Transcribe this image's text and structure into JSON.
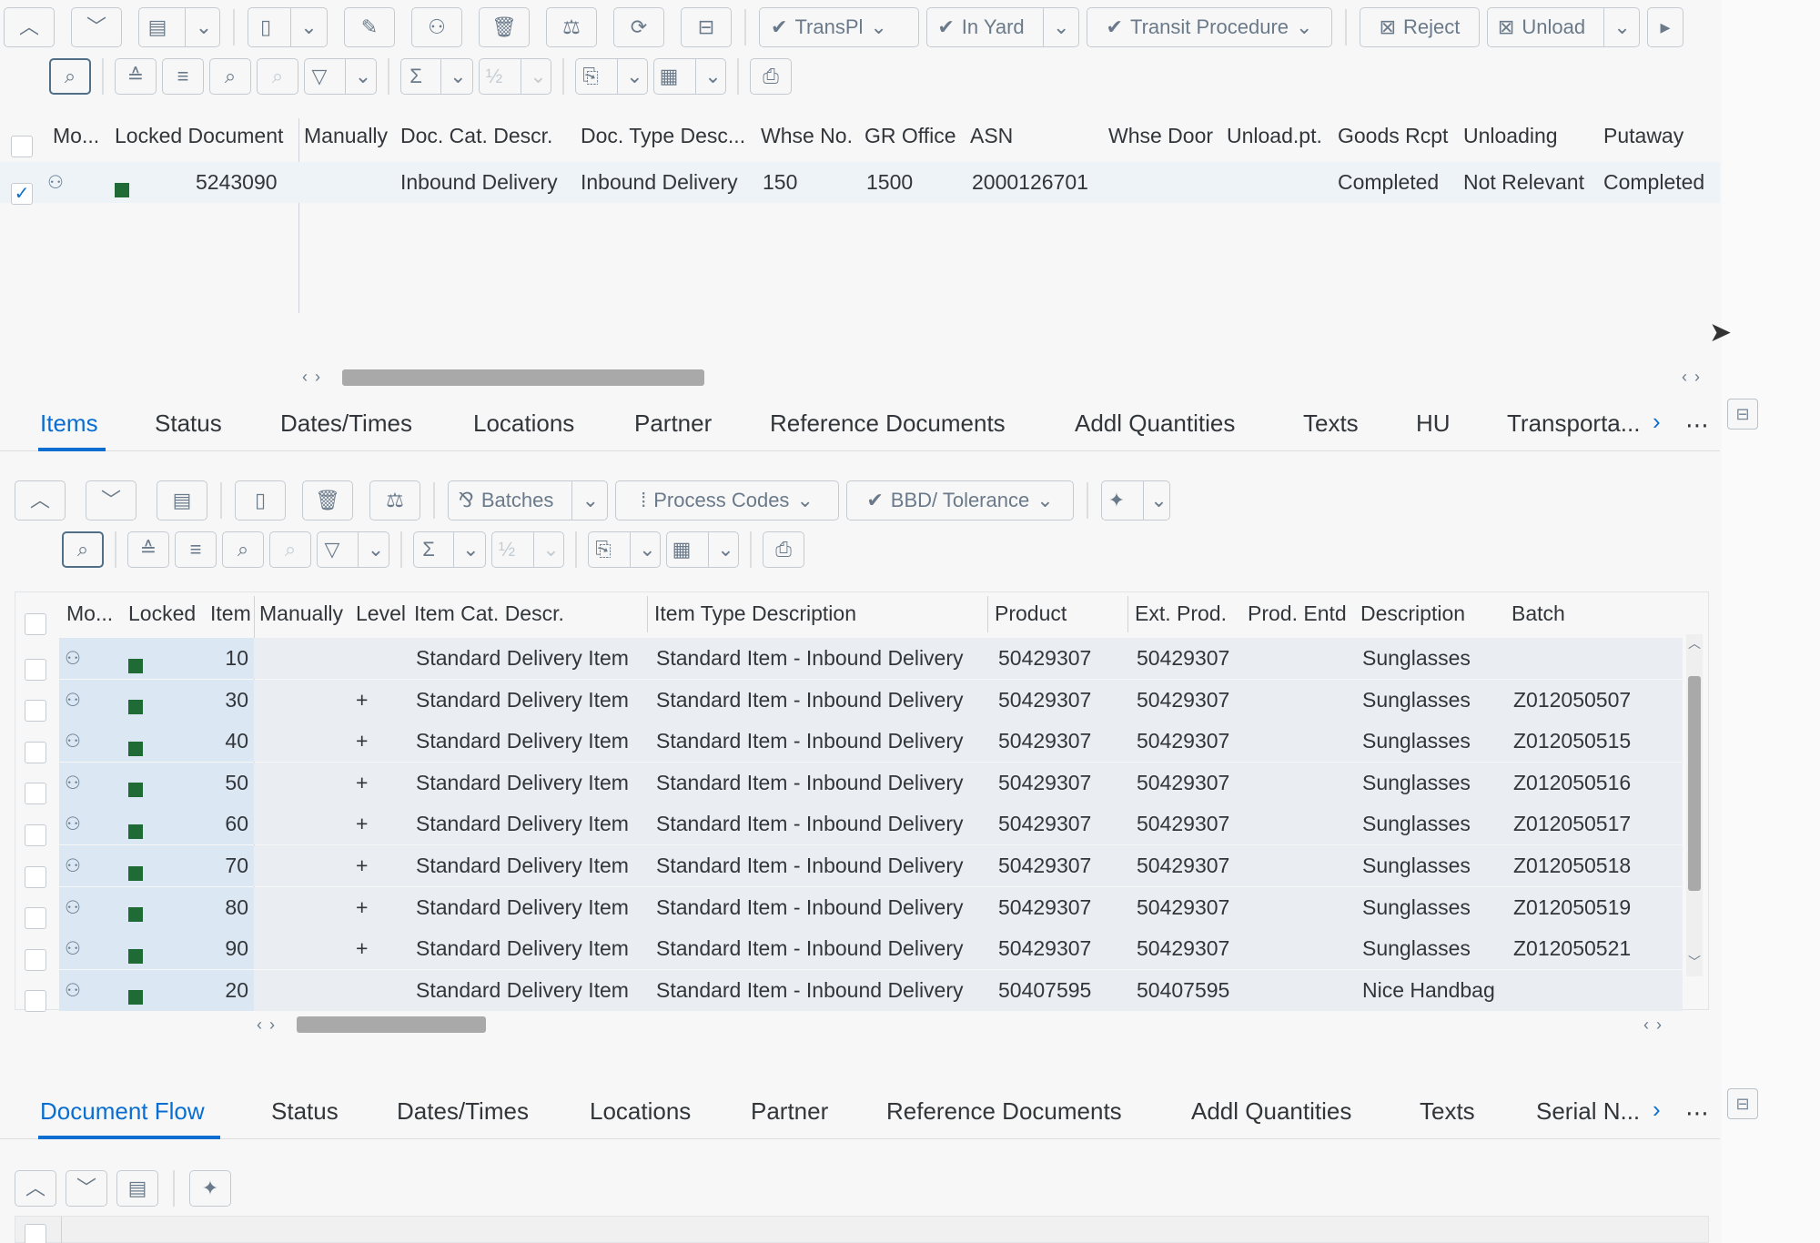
{
  "top_toolbar": {
    "transpl_label": "TransPl",
    "in_yard_label": "In Yard",
    "transit_label": "Transit Procedure",
    "reject_label": "Reject",
    "unload_label": "Unload"
  },
  "header_table": {
    "columns": [
      "Mo...",
      "Locked Document",
      "Manually",
      "Doc. Cat. Descr.",
      "Doc. Type Desc...",
      "Whse No.",
      "GR Office",
      "ASN",
      "Whse Door",
      "Unload.pt.",
      "Goods Rcpt",
      "Unloading",
      "Putaway"
    ],
    "row": {
      "document": "5243090",
      "doc_cat": "Inbound Delivery",
      "doc_type": "Inbound Delivery",
      "whse_no": "150",
      "gr_office": "1500",
      "asn": "2000126701",
      "goods_rcpt": "Completed",
      "unloading": "Not Relevant",
      "putaway": "Completed"
    }
  },
  "item_tabs": [
    "Items",
    "Status",
    "Dates/Times",
    "Locations",
    "Partner",
    "Reference Documents",
    "Addl Quantities",
    "Texts",
    "HU",
    "Transporta..."
  ],
  "item_toolbar": {
    "batches_label": "Batches",
    "process_codes_label": "Process Codes",
    "bbd_label": "BBD/ Tolerance"
  },
  "items_table": {
    "columns": [
      "Mo...",
      "Locked",
      "Item",
      "Manually",
      "Level",
      "Item Cat. Descr.",
      "Item Type Description",
      "Product",
      "Ext. Prod.",
      "Prod. Entd",
      "Description",
      "Batch"
    ],
    "rows": [
      {
        "item": "10",
        "level": "",
        "cat": "Standard Delivery Item",
        "type": "Standard Item - Inbound Delivery",
        "product": "50429307",
        "ext": "50429307",
        "desc": "Sunglasses",
        "batch": ""
      },
      {
        "item": "30",
        "level": "+",
        "cat": "Standard Delivery Item",
        "type": "Standard Item - Inbound Delivery",
        "product": "50429307",
        "ext": "50429307",
        "desc": "Sunglasses",
        "batch": "Z012050507"
      },
      {
        "item": "40",
        "level": "+",
        "cat": "Standard Delivery Item",
        "type": "Standard Item - Inbound Delivery",
        "product": "50429307",
        "ext": "50429307",
        "desc": "Sunglasses",
        "batch": "Z012050515"
      },
      {
        "item": "50",
        "level": "+",
        "cat": "Standard Delivery Item",
        "type": "Standard Item - Inbound Delivery",
        "product": "50429307",
        "ext": "50429307",
        "desc": "Sunglasses",
        "batch": "Z012050516"
      },
      {
        "item": "60",
        "level": "+",
        "cat": "Standard Delivery Item",
        "type": "Standard Item - Inbound Delivery",
        "product": "50429307",
        "ext": "50429307",
        "desc": "Sunglasses",
        "batch": "Z012050517"
      },
      {
        "item": "70",
        "level": "+",
        "cat": "Standard Delivery Item",
        "type": "Standard Item - Inbound Delivery",
        "product": "50429307",
        "ext": "50429307",
        "desc": "Sunglasses",
        "batch": "Z012050518"
      },
      {
        "item": "80",
        "level": "+",
        "cat": "Standard Delivery Item",
        "type": "Standard Item - Inbound Delivery",
        "product": "50429307",
        "ext": "50429307",
        "desc": "Sunglasses",
        "batch": "Z012050519"
      },
      {
        "item": "90",
        "level": "+",
        "cat": "Standard Delivery Item",
        "type": "Standard Item - Inbound Delivery",
        "product": "50429307",
        "ext": "50429307",
        "desc": "Sunglasses",
        "batch": "Z012050521"
      },
      {
        "item": "20",
        "level": "",
        "cat": "Standard Delivery Item",
        "type": "Standard Item - Inbound Delivery",
        "product": "50407595",
        "ext": "50407595",
        "desc": "Nice Handbag",
        "batch": ""
      }
    ]
  },
  "flow_tabs": [
    "Document Flow",
    "Status",
    "Dates/Times",
    "Locations",
    "Partner",
    "Reference Documents",
    "Addl Quantities",
    "Texts",
    "Serial N..."
  ],
  "colors": {
    "accent": "#0a6ed1",
    "locked_green": "#1e6b35",
    "selection_blue": "#dbe7f3"
  },
  "icons": [
    "chevron-up-icon",
    "chevron-down-icon",
    "layout-icon",
    "copy-icon",
    "edit-icon",
    "glasses-icon",
    "trash-icon",
    "scale-icon",
    "refresh-icon",
    "save-icon",
    "zoom-icon",
    "sort-asc-icon",
    "sort-desc-icon",
    "search-icon",
    "filter-icon",
    "sum-icon",
    "export-icon",
    "table-settings-icon",
    "print-preview-icon",
    "overflow-icon",
    "cursor-icon"
  ]
}
